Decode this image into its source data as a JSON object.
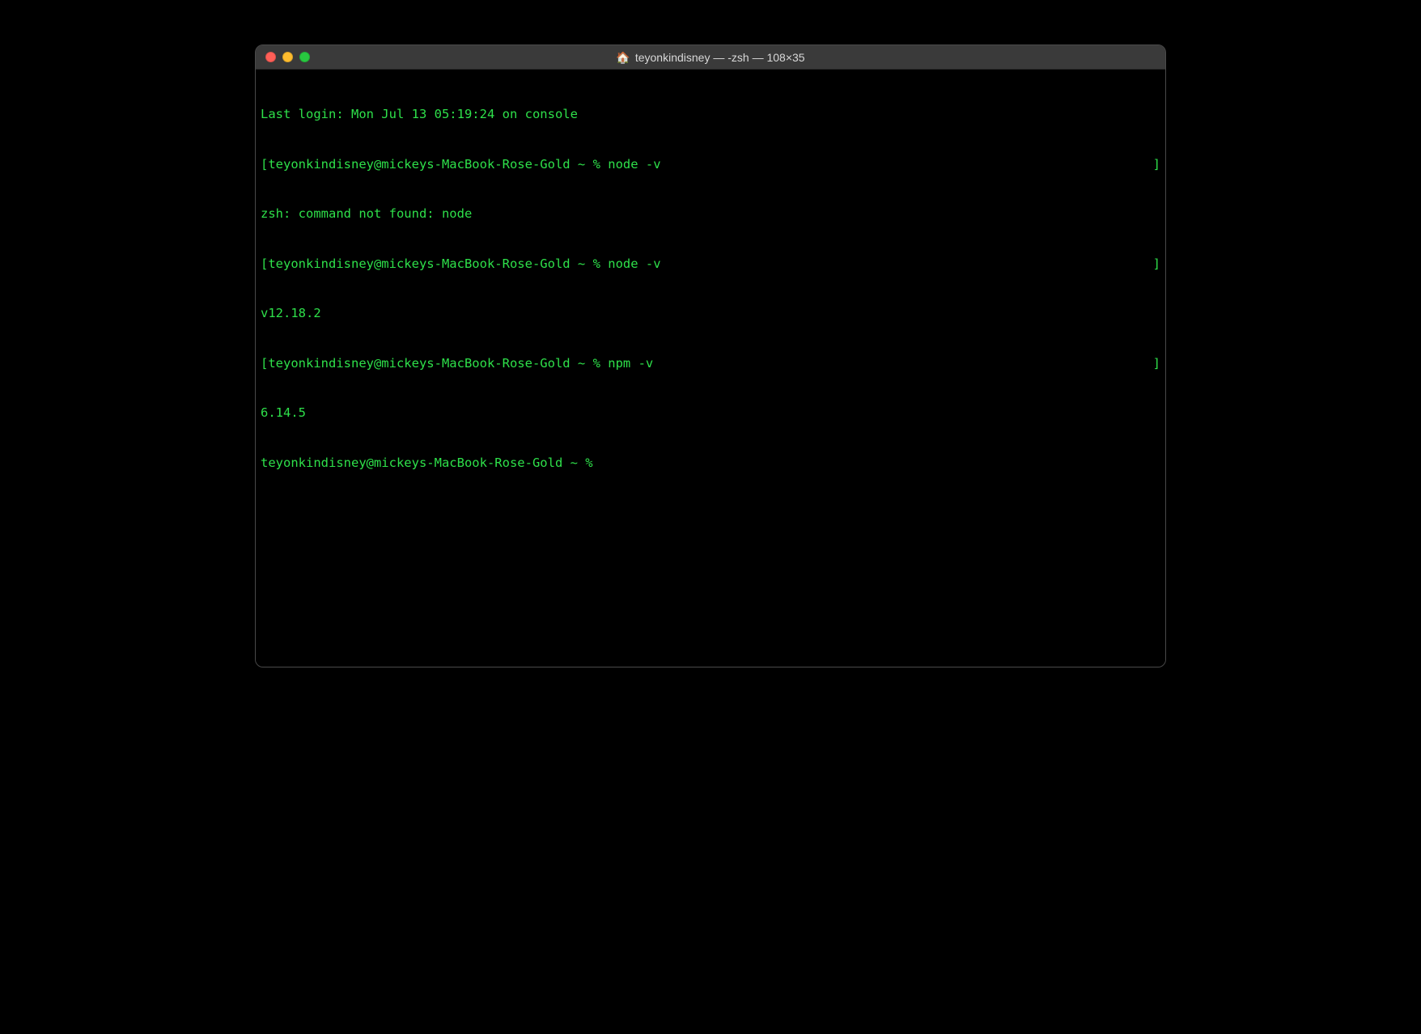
{
  "window": {
    "title": "teyonkindisney — -zsh — 108×35",
    "icon": "🏠"
  },
  "terminal": {
    "lines": [
      {
        "left": "Last login: Mon Jul 13 05:19:24 on console",
        "right": ""
      },
      {
        "left": "[teyonkindisney@mickeys-MacBook-Rose-Gold ~ % node -v",
        "right": "]"
      },
      {
        "left": "zsh: command not found: node",
        "right": ""
      },
      {
        "left": "[teyonkindisney@mickeys-MacBook-Rose-Gold ~ % node -v",
        "right": "]"
      },
      {
        "left": "v12.18.2",
        "right": ""
      },
      {
        "left": "[teyonkindisney@mickeys-MacBook-Rose-Gold ~ % npm -v",
        "right": "]"
      },
      {
        "left": "6.14.5",
        "right": ""
      },
      {
        "left": "teyonkindisney@mickeys-MacBook-Rose-Gold ~ % ",
        "right": ""
      }
    ]
  }
}
